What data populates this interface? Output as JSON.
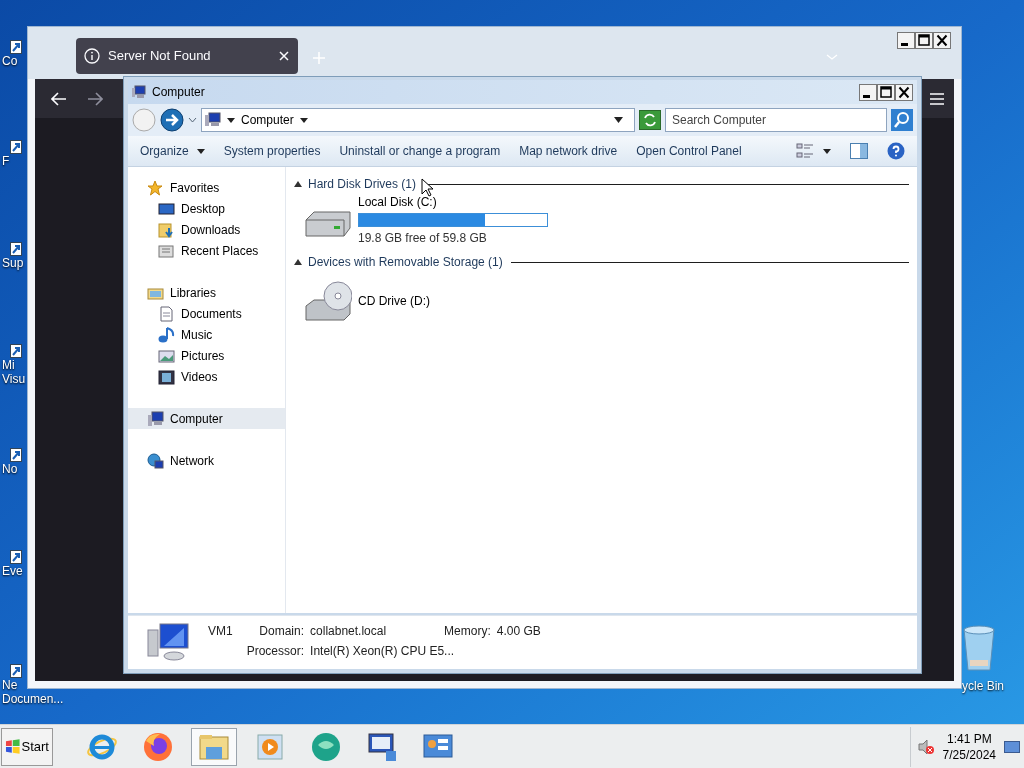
{
  "desktop_icons": [
    {
      "lines": [
        "Co"
      ],
      "kind": "shortcut"
    },
    {
      "lines": [
        "F"
      ],
      "kind": "shortcut"
    },
    {
      "lines": [
        "Sup"
      ],
      "kind": "shortcut"
    },
    {
      "lines": [
        "Mi",
        "Visu"
      ],
      "kind": "shortcut"
    },
    {
      "lines": [
        "No"
      ],
      "kind": "shortcut"
    },
    {
      "lines": [
        "Eve"
      ],
      "kind": "shortcut"
    },
    {
      "lines": [
        "Ne",
        "Documen..."
      ],
      "kind": "shortcut"
    },
    {
      "lines": [
        "ycle Bin"
      ],
      "kind": "recycle-bin"
    }
  ],
  "browser": {
    "tab": {
      "title": "Server Not Found"
    }
  },
  "explorer": {
    "window": {
      "title": "Computer"
    },
    "address": {
      "breadcrumb": "Computer"
    },
    "search": {
      "placeholder": "Search Computer"
    },
    "commands": [
      {
        "label": "Organize",
        "dropdown": true
      },
      {
        "label": "System properties",
        "dropdown": false
      },
      {
        "label": "Uninstall or change a program",
        "dropdown": false
      },
      {
        "label": "Map network drive",
        "dropdown": false
      },
      {
        "label": "Open Control Panel",
        "dropdown": false
      }
    ],
    "sidebar": {
      "items": [
        {
          "label": "Favorites",
          "kind": "favorites",
          "selected": false,
          "children": [
            {
              "label": "Desktop",
              "kind": "desktop",
              "selected": false
            },
            {
              "label": "Downloads",
              "kind": "downloads",
              "selected": false
            },
            {
              "label": "Recent Places",
              "kind": "recent",
              "selected": false
            }
          ]
        },
        {
          "label": "Libraries",
          "kind": "libraries",
          "selected": false,
          "children": [
            {
              "label": "Documents",
              "kind": "documents",
              "selected": false
            },
            {
              "label": "Music",
              "kind": "music",
              "selected": false
            },
            {
              "label": "Pictures",
              "kind": "pictures",
              "selected": false
            },
            {
              "label": "Videos",
              "kind": "videos",
              "selected": false
            }
          ]
        },
        {
          "label": "Computer",
          "kind": "computer",
          "selected": true
        },
        {
          "label": "Network",
          "kind": "network",
          "selected": false
        }
      ]
    },
    "groups": [
      {
        "title": "Hard Disk Drives (1)",
        "expanded": true,
        "items": [
          {
            "name": "Local Disk (C:)",
            "kind": "disk",
            "level": 0.67,
            "free": "19.8 GB free of 59.8 GB"
          }
        ]
      },
      {
        "title": "Devices with Removable Storage (1)",
        "expanded": true,
        "items": [
          {
            "name": "CD Drive (D:)",
            "kind": "cd"
          }
        ]
      }
    ],
    "details": {
      "name": "VM1",
      "fields": [
        {
          "label": "Domain:",
          "value": "collabnet.local"
        },
        {
          "label": "Memory:",
          "value": "4.00 GB"
        },
        {
          "label": "Processor:",
          "value": "Intel(R) Xeon(R) CPU E5..."
        }
      ]
    }
  },
  "taskbar": {
    "start": "Start",
    "apps": [
      {
        "kind": "ie",
        "selected": false
      },
      {
        "kind": "firefox",
        "selected": false
      },
      {
        "kind": "explorer",
        "selected": true
      },
      {
        "kind": "media",
        "selected": false
      },
      {
        "kind": "bubble",
        "selected": false
      },
      {
        "kind": "monitor",
        "selected": false
      },
      {
        "kind": "panel",
        "selected": false
      }
    ],
    "clock": {
      "time": "1:41 PM",
      "date": "7/25/2024"
    }
  }
}
